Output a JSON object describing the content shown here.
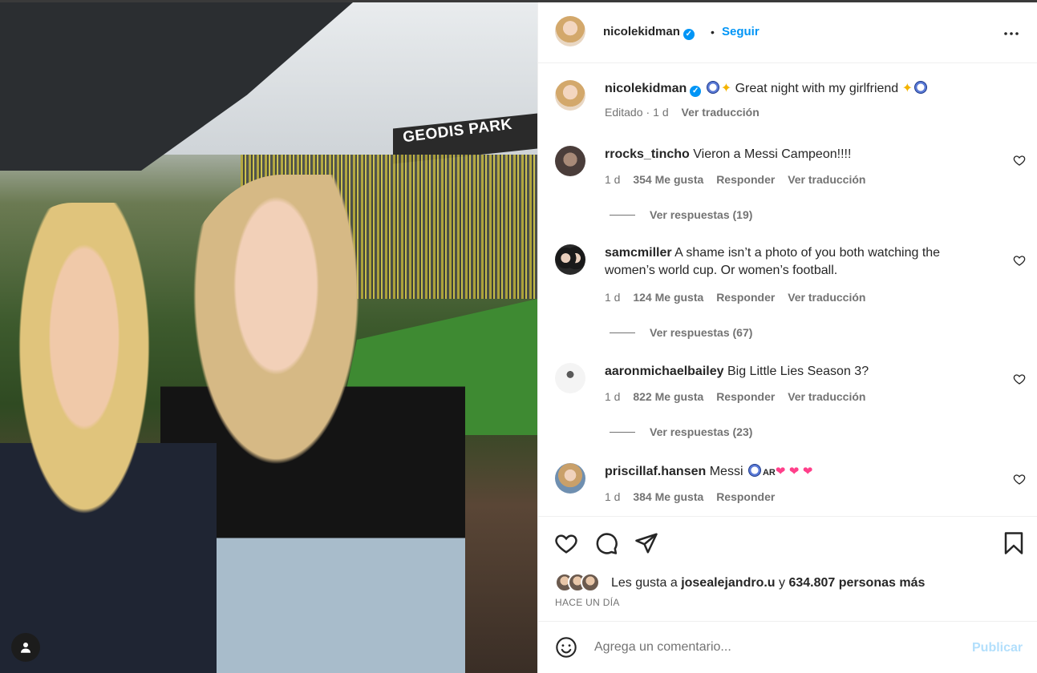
{
  "header": {
    "username": "nicolekidman",
    "separator": "•",
    "follow_label": "Seguir"
  },
  "caption": {
    "username": "nicolekidman",
    "text": "Great night with my girlfriend",
    "edited": "Editado",
    "time": "1 d",
    "translate": "Ver traducción"
  },
  "photo": {
    "sign_text": "GEODIS PARK"
  },
  "comments": [
    {
      "username": "rrocks_tincho",
      "text": "Vieron a Messi Campeon!!!!",
      "time": "1 d",
      "likes": "354 Me gusta",
      "reply": "Responder",
      "translate": "Ver traducción",
      "replies": "Ver respuestas (19)"
    },
    {
      "username": "samcmiller",
      "text": "A shame isn’t a photo of you both watching the women’s world cup. Or women’s football.",
      "time": "1 d",
      "likes": "124 Me gusta",
      "reply": "Responder",
      "translate": "Ver traducción",
      "replies": "Ver respuestas (67)"
    },
    {
      "username": "aaronmichaelbailey",
      "text": "Big Little Lies Season 3?",
      "time": "1 d",
      "likes": "822 Me gusta",
      "reply": "Responder",
      "translate": "Ver traducción",
      "replies": "Ver respuestas (23)"
    },
    {
      "username": "priscillaf.hansen",
      "text": "Messi",
      "flag": "AR",
      "time": "1 d",
      "likes": "384 Me gusta",
      "reply": "Responder"
    }
  ],
  "likes": {
    "prefix": "Les gusta a",
    "user": "josealejandro.u",
    "conj": "y",
    "others": "634.807 personas más"
  },
  "time_ago": "HACE UN DÍA",
  "compose": {
    "placeholder": "Agrega un comentario...",
    "publish": "Publicar"
  },
  "colors": {
    "accent": "#0095f6",
    "publish_disabled": "#b2dffc",
    "muted": "#737373",
    "text": "#262626"
  },
  "icons": [
    "user-tag-icon",
    "verified-badge-icon",
    "more-options-icon",
    "heart-icon",
    "comment-icon",
    "share-icon",
    "bookmark-icon",
    "emoji-icon",
    "soccer-ball-emoji",
    "sparkles-emoji",
    "two-hearts-emoji"
  ]
}
